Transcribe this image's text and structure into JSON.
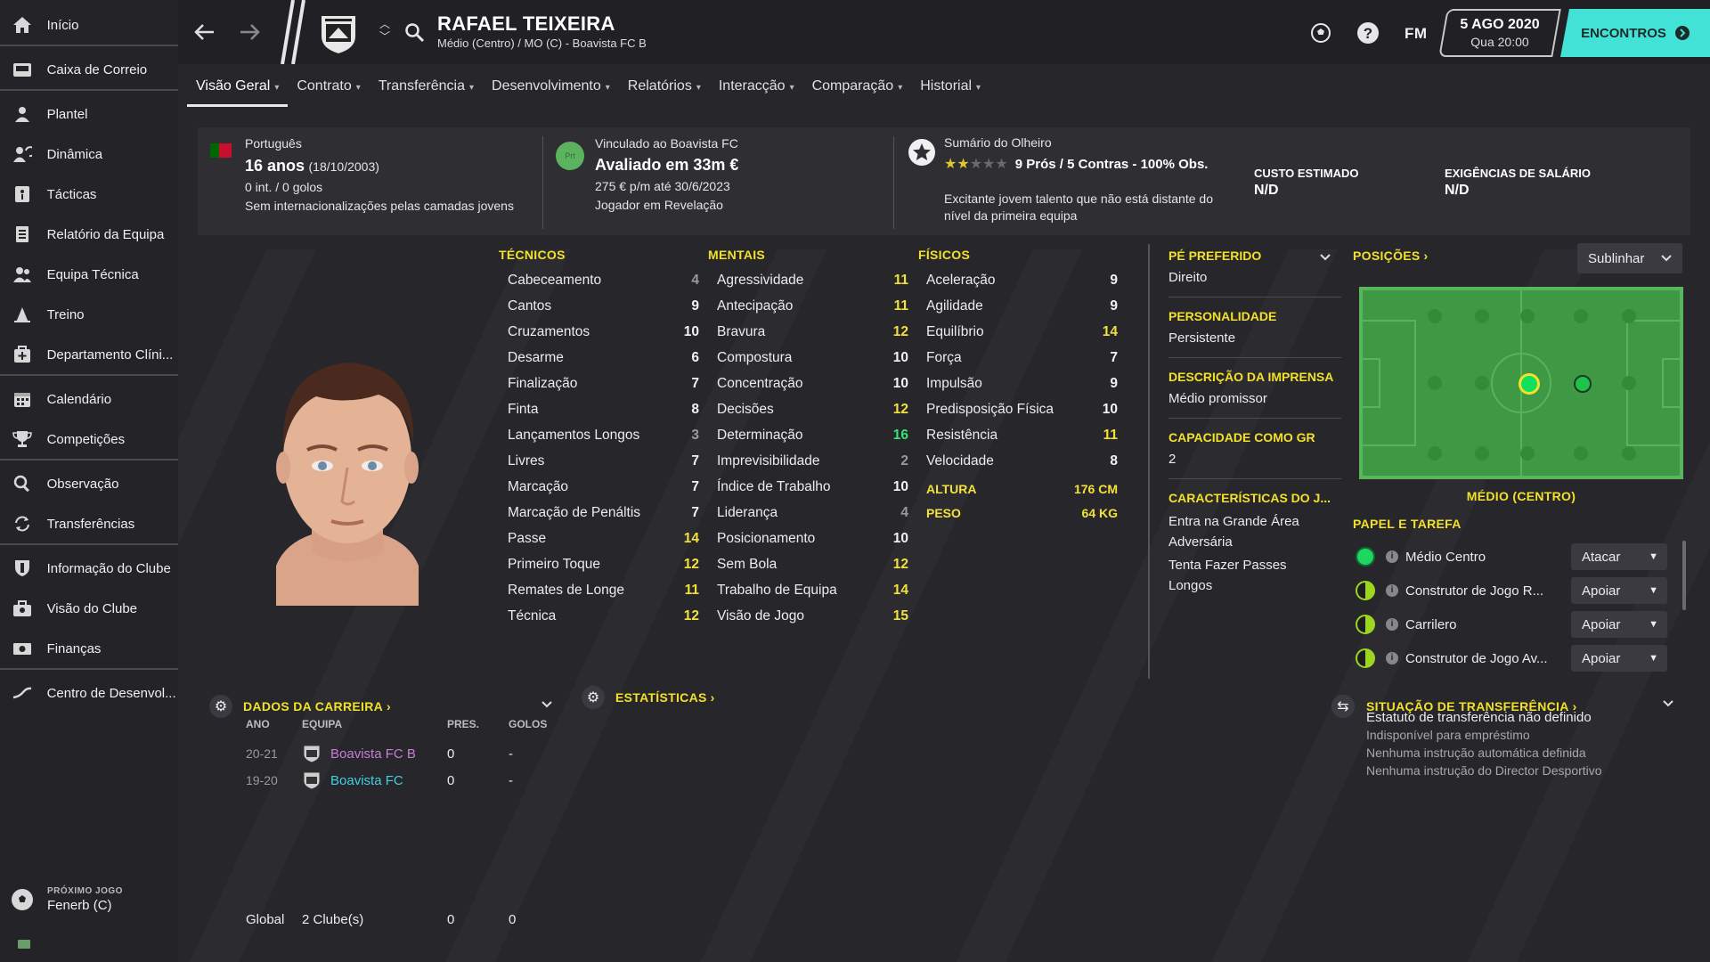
{
  "sidebar": {
    "items": [
      {
        "label": "Início",
        "icon": "home-icon"
      },
      {
        "label": "Caixa de Correio",
        "icon": "inbox-icon"
      },
      {
        "label": "Plantel",
        "icon": "squad-icon"
      },
      {
        "label": "Dinâmica",
        "icon": "dynamics-icon"
      },
      {
        "label": "Tácticas",
        "icon": "tactics-icon"
      },
      {
        "label": "Relatório da Equipa",
        "icon": "report-icon"
      },
      {
        "label": "Equipa Técnica",
        "icon": "staff-icon"
      },
      {
        "label": "Treino",
        "icon": "training-icon"
      },
      {
        "label": "Departamento Clíni...",
        "icon": "medical-icon"
      },
      {
        "label": "Calendário",
        "icon": "calendar-icon"
      },
      {
        "label": "Competições",
        "icon": "trophy-icon"
      },
      {
        "label": "Observação",
        "icon": "scouting-icon"
      },
      {
        "label": "Transferências",
        "icon": "transfers-icon"
      },
      {
        "label": "Informação do Clube",
        "icon": "club-info-icon"
      },
      {
        "label": "Visão do Clube",
        "icon": "club-vision-icon"
      },
      {
        "label": "Finanças",
        "icon": "finances-icon"
      },
      {
        "label": "Centro de Desenvol...",
        "icon": "development-icon"
      }
    ],
    "next_game_label": "PRÓXIMO JOGO",
    "next_game_value": "Fenerb (C)"
  },
  "header": {
    "player_name": "RAFAEL TEIXEIRA",
    "subtitle": "Médio (Centro) / MO (C) - Boavista FC B",
    "fm_label": "FM",
    "date": "5 AGO 2020",
    "time": "Qua 20:00",
    "continue_label": "ENCONTROS"
  },
  "tabs": [
    "Visão Geral",
    "Contrato",
    "Transferência",
    "Desenvolvimento",
    "Relatórios",
    "Interacção",
    "Comparação",
    "Historial"
  ],
  "info": {
    "nationality": "Português",
    "age": "16 anos",
    "dob": "(18/10/2003)",
    "caps": "0 int. / 0 golos",
    "youth_caps": "Sem internacionalizações pelas camadas jovens",
    "contract_badge": "Prt",
    "contract": "Vinculado ao Boavista FC",
    "value": "Avaliado em 33m €",
    "wage": "275 € p/m até 30/6/2023",
    "status": "Jogador em Revelação",
    "scout_title": "Sumário do Olheiro",
    "scout_summary": "9 Prós / 5 Contras - 100% Obs.",
    "scout_stars": 2,
    "scout_stars_max": 5,
    "scout_text_1": "Excitante jovem talento que não está distante do",
    "scout_text_2": "nível da primeira equipa",
    "cost_label": "CUSTO ESTIMADO",
    "cost_value": "N/D",
    "wage_demand_label": "EXIGÊNCIAS DE SALÁRIO",
    "wage_demand_value": "N/D"
  },
  "attributes": {
    "technical_title": "TÉCNICOS",
    "technical": [
      {
        "name": "Cabeceamento",
        "value": 4
      },
      {
        "name": "Cantos",
        "value": 9
      },
      {
        "name": "Cruzamentos",
        "value": 10
      },
      {
        "name": "Desarme",
        "value": 6
      },
      {
        "name": "Finalização",
        "value": 7
      },
      {
        "name": "Finta",
        "value": 8
      },
      {
        "name": "Lançamentos Longos",
        "value": 3
      },
      {
        "name": "Livres",
        "value": 7
      },
      {
        "name": "Marcação",
        "value": 7
      },
      {
        "name": "Marcação de Penáltis",
        "value": 7
      },
      {
        "name": "Passe",
        "value": 14
      },
      {
        "name": "Primeiro Toque",
        "value": 12
      },
      {
        "name": "Remates de Longe",
        "value": 11
      },
      {
        "name": "Técnica",
        "value": 12
      }
    ],
    "mental_title": "MENTAIS",
    "mental": [
      {
        "name": "Agressividade",
        "value": 11
      },
      {
        "name": "Antecipação",
        "value": 11
      },
      {
        "name": "Bravura",
        "value": 12
      },
      {
        "name": "Compostura",
        "value": 10
      },
      {
        "name": "Concentração",
        "value": 10
      },
      {
        "name": "Decisões",
        "value": 12
      },
      {
        "name": "Determinação",
        "value": 16
      },
      {
        "name": "Imprevisibilidade",
        "value": 2
      },
      {
        "name": "Índice de Trabalho",
        "value": 10
      },
      {
        "name": "Liderança",
        "value": 4
      },
      {
        "name": "Posicionamento",
        "value": 10
      },
      {
        "name": "Sem Bola",
        "value": 12
      },
      {
        "name": "Trabalho de Equipa",
        "value": 14
      },
      {
        "name": "Visão de Jogo",
        "value": 15
      }
    ],
    "physical_title": "FÍSICOS",
    "physical": [
      {
        "name": "Aceleração",
        "value": 9
      },
      {
        "name": "Agilidade",
        "value": 9
      },
      {
        "name": "Equilíbrio",
        "value": 14
      },
      {
        "name": "Força",
        "value": 7
      },
      {
        "name": "Impulsão",
        "value": 9
      },
      {
        "name": "Predisposição Física",
        "value": 10
      },
      {
        "name": "Resistência",
        "value": 11
      },
      {
        "name": "Velocidade",
        "value": 8
      }
    ],
    "height_label": "ALTURA",
    "height_value": "176 CM",
    "weight_label": "PESO",
    "weight_value": "64 KG"
  },
  "profile": {
    "foot_label": "PÉ PREFERIDO",
    "foot_value": "Direito",
    "personality_label": "PERSONALIDADE",
    "personality_value": "Persistente",
    "media_label": "DESCRIÇÃO DA IMPRENSA",
    "media_value": "Médio promissor",
    "gk_label": "CAPACIDADE COMO GR",
    "gk_value": "2",
    "traits_label": "CARACTERÍSTICAS DO J...",
    "trait_1": "Entra na Grande Área",
    "trait_1b": "Adversária",
    "trait_2": "Tenta Fazer Passes",
    "trait_2b": "Longos"
  },
  "positions": {
    "title": "POSIÇÕES",
    "highlight_select": "Sublinhar",
    "position_name": "MÉDIO (CENTRO)",
    "roles_title": "PAPEL E TAREFA",
    "roles": [
      {
        "name": "Médio Centro",
        "duty": "Atacar",
        "color": "#1ed760"
      },
      {
        "name": "Construtor de Jogo R...",
        "duty": "Apoiar",
        "color": "#9cd61e"
      },
      {
        "name": "Carrilero",
        "duty": "Apoiar",
        "color": "#9cd61e"
      },
      {
        "name": "Construtor de Jogo Av...",
        "duty": "Apoiar",
        "color": "#9cd61e"
      }
    ]
  },
  "career": {
    "title": "DADOS DA CARREIRA",
    "col_year": "ANO",
    "col_team": "EQUIPA",
    "col_apps": "PRES.",
    "col_goals": "GOLOS",
    "rows": [
      {
        "year": "20-21",
        "team": "Boavista FC B",
        "apps": "0",
        "goals": "-",
        "color": "#c77dd6"
      },
      {
        "year": "19-20",
        "team": "Boavista FC",
        "apps": "0",
        "goals": "-",
        "color": "#3fd0e0"
      }
    ],
    "total_label": "Global",
    "total_team": "2 Clube(s)",
    "total_apps": "0",
    "total_goals": "0"
  },
  "stats": {
    "title": "ESTATÍSTICAS"
  },
  "transfer": {
    "title": "SITUAÇÃO DE TRANSFERÊNCIA",
    "status": "Estatuto de transferência não definido",
    "line1": "Indisponível para empréstimo",
    "line2": "Nenhuma instrução automática definida",
    "line3": "Nenhuma instrução do Director Desportivo"
  },
  "colors": {
    "accent": "#42e3d6",
    "attr_yellow": "#f3e13a",
    "attr_green": "#39e178",
    "section_yellow": "#f2e02a"
  }
}
